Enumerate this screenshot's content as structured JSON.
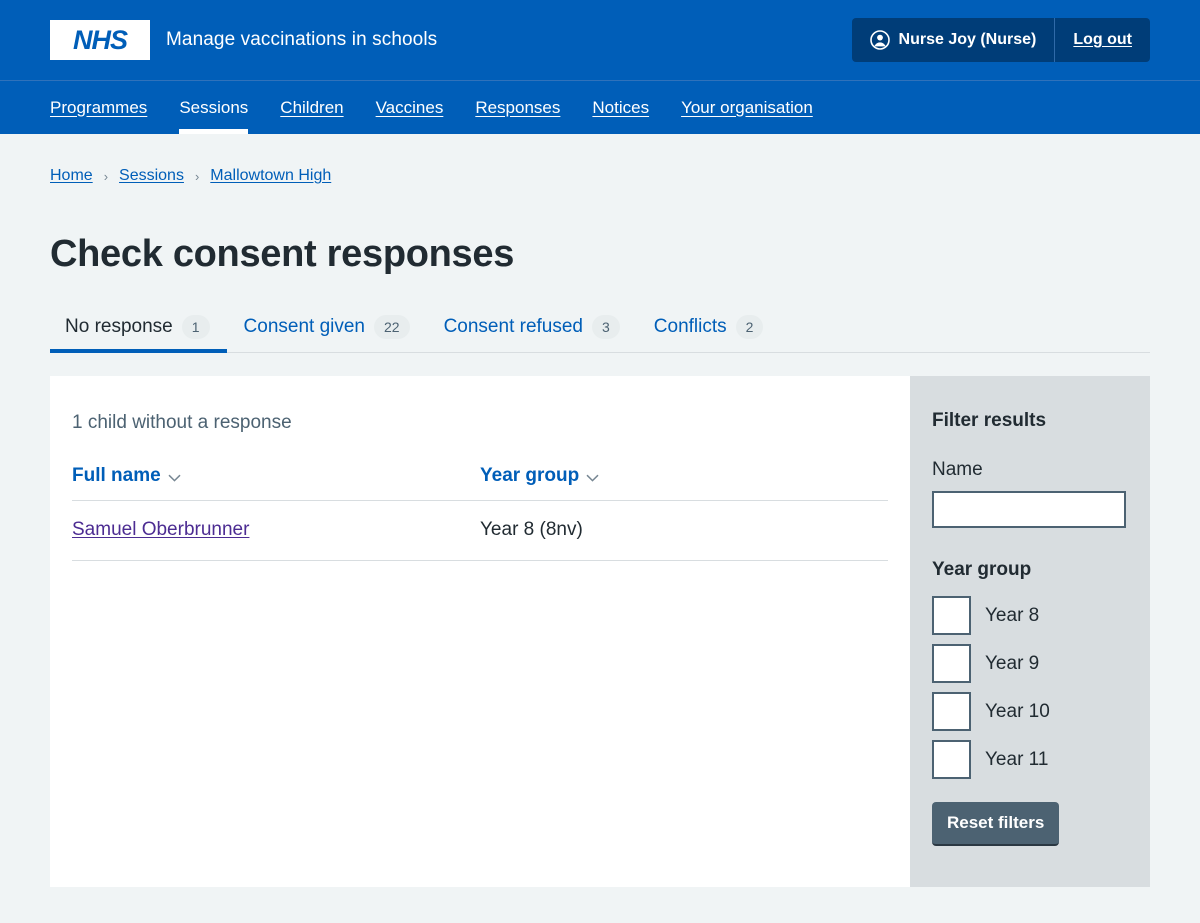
{
  "header": {
    "logo_alt": "NHS",
    "service_name": "Manage vaccinations in schools",
    "account_name": "Nurse Joy (Nurse)",
    "logout_label": "Log out"
  },
  "nav": {
    "items": [
      {
        "label": "Programmes",
        "active": false
      },
      {
        "label": "Sessions",
        "active": true
      },
      {
        "label": "Children",
        "active": false
      },
      {
        "label": "Vaccines",
        "active": false
      },
      {
        "label": "Responses",
        "active": false
      },
      {
        "label": "Notices",
        "active": false
      },
      {
        "label": "Your organisation",
        "active": false
      }
    ]
  },
  "breadcrumb": {
    "items": [
      {
        "label": "Home"
      },
      {
        "label": "Sessions"
      },
      {
        "label": "Mallowtown High"
      }
    ],
    "separator": "›"
  },
  "main": {
    "title": "Check consent responses",
    "tabs": [
      {
        "label": "No response",
        "count": "1",
        "active": true
      },
      {
        "label": "Consent given",
        "count": "22",
        "active": false
      },
      {
        "label": "Consent refused",
        "count": "3",
        "active": false
      },
      {
        "label": "Conflicts",
        "count": "2",
        "active": false
      }
    ],
    "results": {
      "count_caption": "1 child without a response",
      "columns": [
        {
          "label": "Full name",
          "sortable": true,
          "sort_icon": "chevron-down-icon"
        },
        {
          "label": "Year group",
          "sortable": true,
          "sort_icon": "chevron-down-icon"
        }
      ],
      "rows": [
        {
          "name": "Samuel Oberbrunner",
          "year_group": "Year 8 (8nv)"
        }
      ]
    }
  },
  "filters": {
    "heading": "Filter results",
    "name_label": "Name",
    "name_value": "",
    "name_placeholder": "",
    "year_group_heading": "Year group",
    "year_groups": [
      {
        "label": "Year 8",
        "checked": false
      },
      {
        "label": "Year 9",
        "checked": false
      },
      {
        "label": "Year 10",
        "checked": false
      },
      {
        "label": "Year 11",
        "checked": false
      }
    ],
    "reset_label": "Reset filters"
  },
  "colors": {
    "nhs_blue": "#005eb8",
    "nhs_dark_blue": "#003d78",
    "page_background": "#f0f4f5",
    "panel_grey": "#d8dde0",
    "text": "#212b32",
    "muted_text": "#4c6272",
    "visited_link": "#4c2c92",
    "button_grey": "#4c6272"
  }
}
